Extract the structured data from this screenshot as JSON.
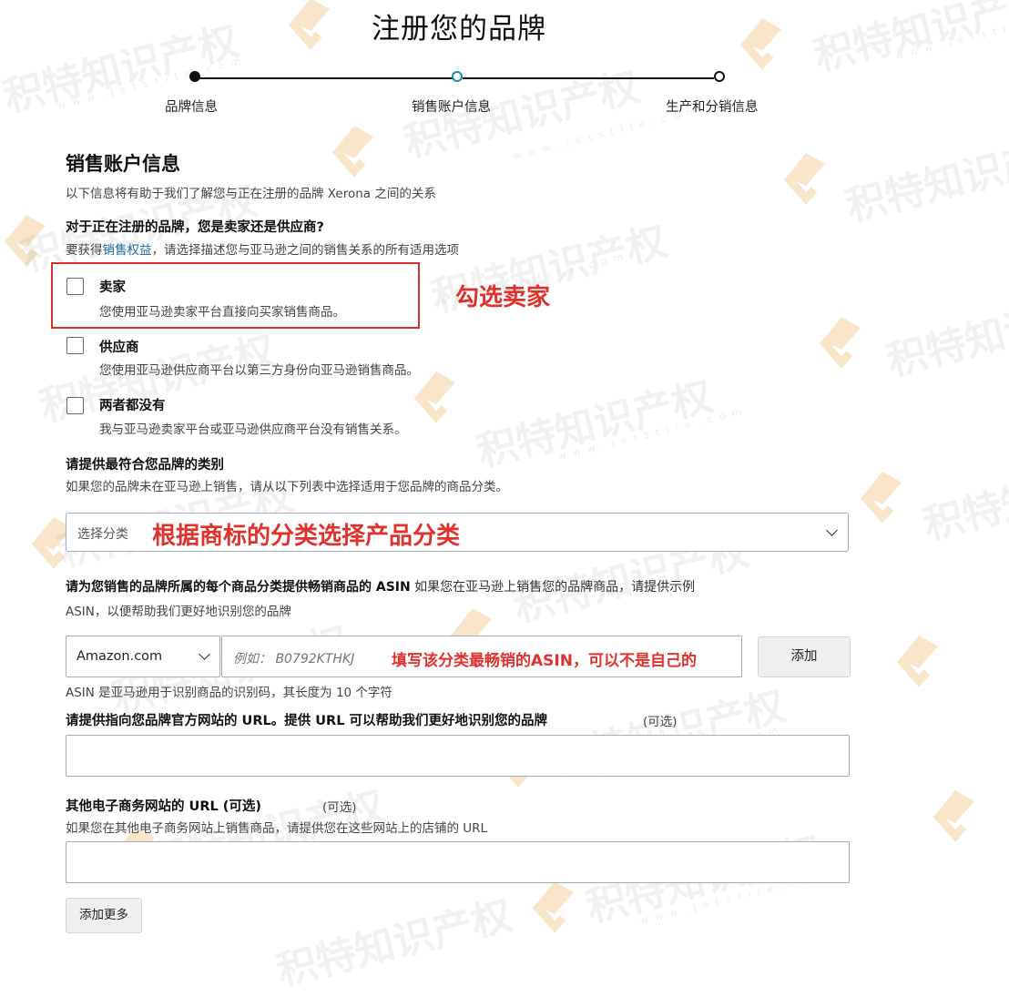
{
  "page": {
    "title": "注册您的品牌"
  },
  "stepper": {
    "steps": [
      {
        "label": "品牌信息",
        "state": "completed"
      },
      {
        "label": "销售账户信息",
        "state": "current"
      },
      {
        "label": "生产和分销信息",
        "state": "upcoming"
      }
    ]
  },
  "section": {
    "title": "销售账户信息",
    "subtitle": "以下信息将有助于我们了解您与正在注册的品牌 Xerona 之间的关系"
  },
  "seller_question": {
    "title": "对于正在注册的品牌，您是卖家还是供应商?",
    "help_prefix": "要获得",
    "help_link": "销售权益",
    "help_suffix": "，请选择描述您与亚马逊之间的销售关系的所有适用选项",
    "options": [
      {
        "label": "卖家",
        "description": "您使用亚马逊卖家平台直接向买家销售商品。",
        "checked": false
      },
      {
        "label": "供应商",
        "description": "您使用亚马逊供应商平台以第三方身份向亚马逊销售商品。",
        "checked": false
      },
      {
        "label": "两者都没有",
        "description": "我与亚马逊卖家平台或亚马逊供应商平台没有销售关系。",
        "checked": false
      }
    ]
  },
  "category_question": {
    "title": "请提供最符合您品牌的类别",
    "help": "如果您的品牌未在亚马逊上销售，请从以下列表中选择适用于您品牌的商品分类。",
    "select_placeholder": "选择分类"
  },
  "asin_question": {
    "title_bold": "请为您销售的品牌所属的每个商品分类提供畅销商品的 ASIN",
    "title_rest": " 如果您在亚马逊上销售您的品牌商品，请提供示例",
    "title_line2": "ASIN，以便帮助我们更好地识别您的品牌",
    "marketplace_selected": "Amazon.com",
    "asin_placeholder": "例如：  B0792KTHKJ",
    "add_button": "添加",
    "hint": "ASIN 是亚马逊用于识别商品的识别码，其长度为 10 个字符"
  },
  "website_question": {
    "title": "请提供指向您品牌官方网站的 URL。提供 URL 可以帮助我们更好地识别您的品牌",
    "optional": "(可选)",
    "value": ""
  },
  "ecommerce_question": {
    "title": "其他电子商务网站的 URL (可选)",
    "optional": "(可选)",
    "help": "如果您在其他电子商务网站上销售商品，请提供您在这些网站上的店铺的 URL",
    "value": "",
    "add_more_button": "添加更多"
  },
  "annotations": {
    "check_seller": "勾选卖家",
    "choose_category": "根据商标的分类选择产品分类",
    "fill_asin": "填写该分类最畅销的ASIN，可以不是自己的"
  },
  "watermark": {
    "text": "积特知识产权",
    "url": "w w w . j e t s t i l e . c o m"
  },
  "colors": {
    "accent": "#1a8ea8",
    "annotation_red": "#e0322d",
    "link": "#1769a3"
  }
}
